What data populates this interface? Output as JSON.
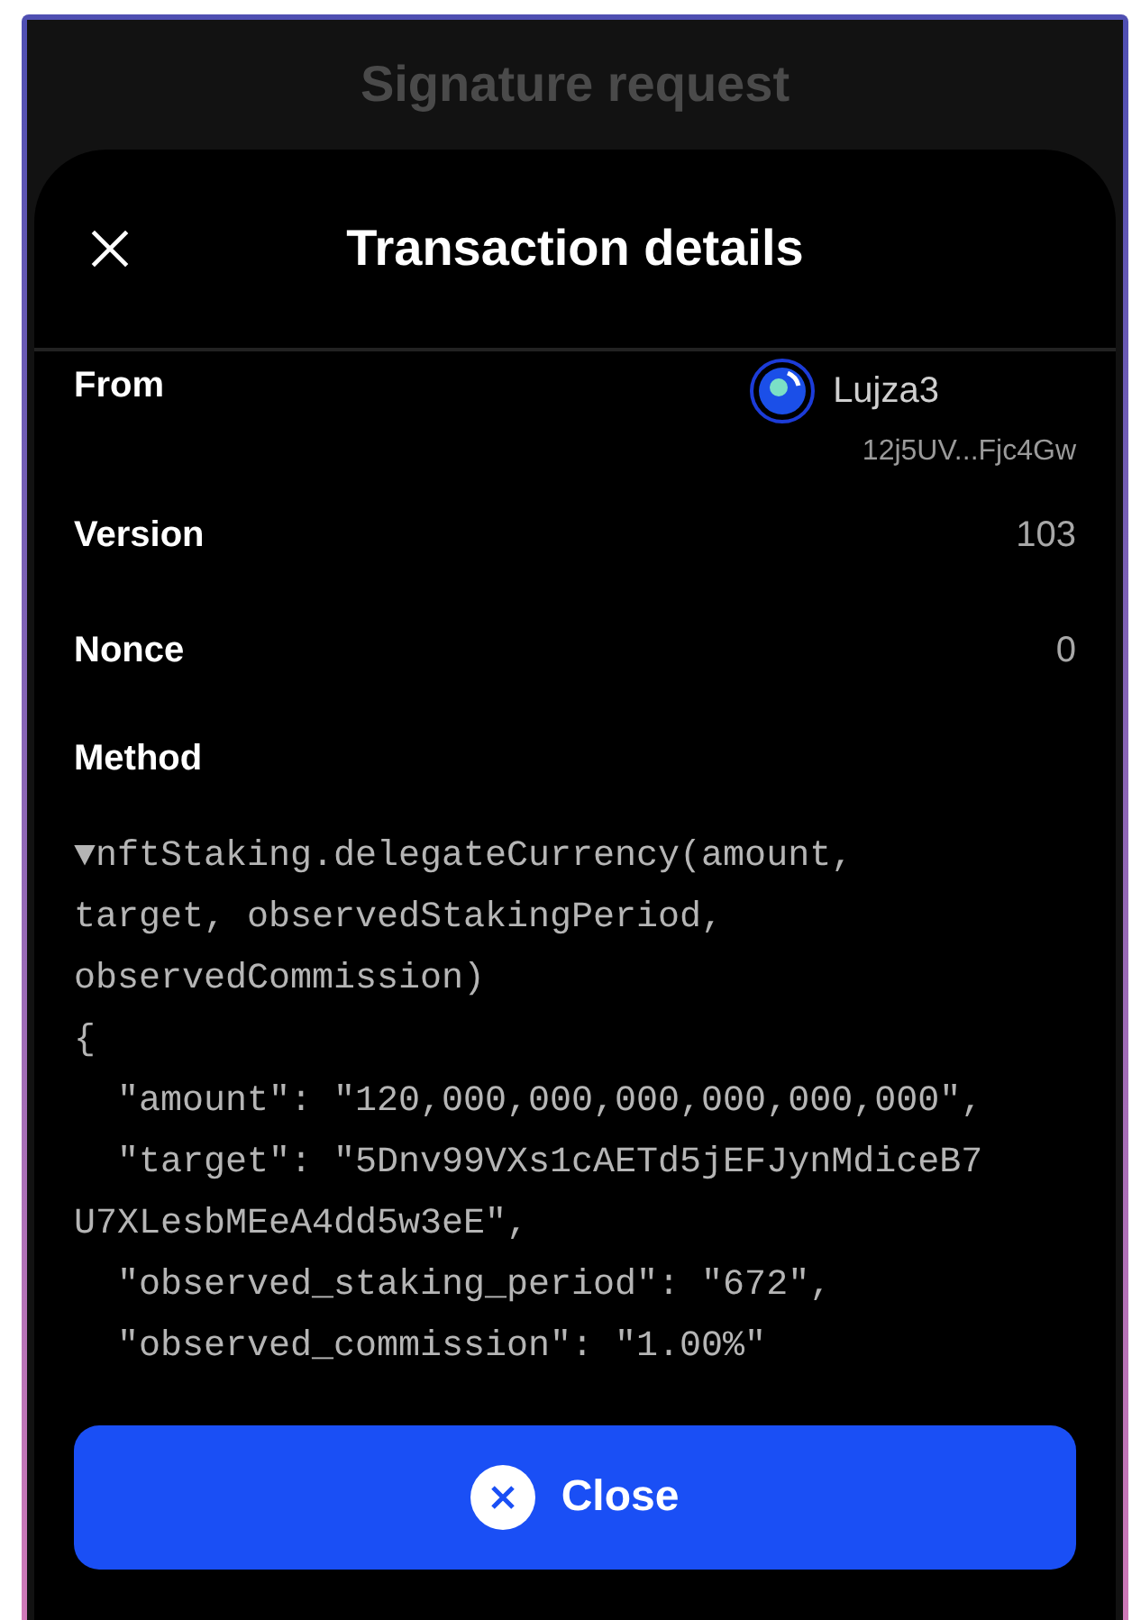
{
  "background_title": "Signature request",
  "sheet": {
    "title": "Transaction details"
  },
  "from": {
    "label": "From",
    "account_name": "Lujza3",
    "address": "12j5UV...Fjc4Gw"
  },
  "rows": [
    {
      "label": "Version",
      "value": "103"
    },
    {
      "label": "Nonce",
      "value": "0"
    }
  ],
  "method": {
    "label": "Method",
    "code_lines": [
      "▼nftStaking.delegateCurrency(amount,",
      "target, observedStakingPeriod,",
      "observedCommission)",
      "{",
      "  \"amount\": \"120,000,000,000,000,000,000\",",
      "  \"target\": \"5Dnv99VXs1cAETd5jEFJynMdiceB7",
      "U7XLesbMEeA4dd5w3eE\",",
      "  \"observed_staking_period\": \"672\",",
      "  \"observed_commission\": \"1.00%\""
    ]
  },
  "close_button": {
    "label": "Close"
  }
}
